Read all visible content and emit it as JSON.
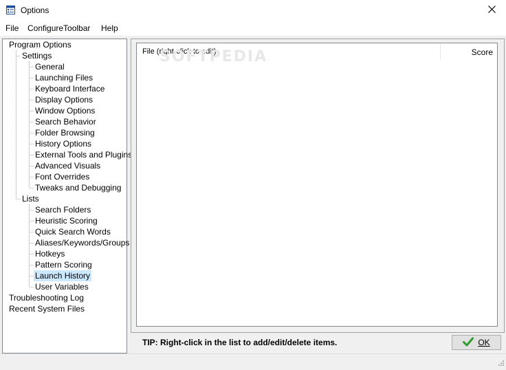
{
  "window": {
    "title": "Options",
    "close_icon": "close-icon",
    "app_icon": "options-list-icon"
  },
  "menu": {
    "items": [
      "File",
      "ConfigureToolbar",
      "Help"
    ]
  },
  "tree": {
    "root": "Program Options",
    "settings": {
      "label": "Settings",
      "children": [
        "General",
        "Launching Files",
        "Keyboard Interface",
        "Display Options",
        "Window Options",
        "Search Behavior",
        "Folder Browsing",
        "History Options",
        "External Tools and Plugins",
        "Advanced Visuals",
        "Font Overrides",
        "Tweaks and Debugging"
      ]
    },
    "lists": {
      "label": "Lists",
      "children": [
        "Search Folders",
        "Heuristic Scoring",
        "Quick Search Words",
        "Aliases/Keywords/Groups",
        "Hotkeys",
        "Pattern Scoring",
        "Launch History",
        "User Variables"
      ]
    },
    "extra": [
      "Troubleshooting Log",
      "Recent System Files"
    ],
    "selected": "Launch History"
  },
  "list": {
    "columns": [
      "File (right-click to edit)",
      "Score"
    ],
    "watermark": "SOFTPEDIA"
  },
  "tip": "TIP: Right-click in the list to add/edit/delete items.",
  "ok_button": {
    "label": "OK",
    "icon": "checkmark-icon"
  },
  "colors": {
    "selection": "#cce8ff",
    "check_green": "#2e9b2e"
  }
}
